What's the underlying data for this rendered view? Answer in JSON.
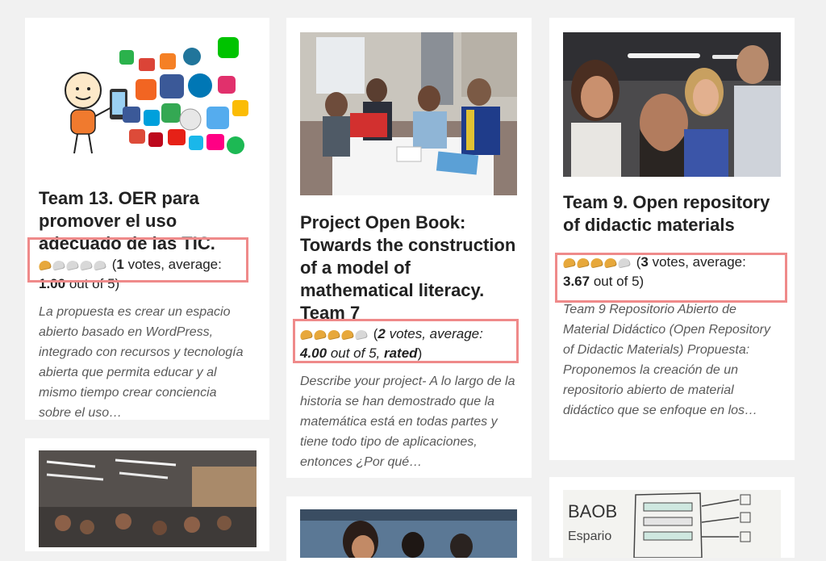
{
  "posts": [
    {
      "title": "Team 13. OER para promover el uso adecuado de las TIC.",
      "rating": {
        "filled": 1,
        "total": 5,
        "votes": "1",
        "votes_word": " votes, average: ",
        "average": "1.00",
        "out_of": " out of 5)",
        "rated": ""
      },
      "excerpt": "La propuesta es crear un espacio abierto basado en WordPress, integrado con recursos y tecnología abierta que permita educar y al mismo tiempo crear conciencia sobre el uso…"
    },
    {
      "title": "Project Open Book: Towards the construction of a model of mathematical literacy. Team 7",
      "rating": {
        "filled": 4,
        "total": 5,
        "votes": "2",
        "votes_word": " votes, average: ",
        "average": "4.00",
        "out_of": " out of 5, ",
        "rated": "rated"
      },
      "excerpt": "Describe your project- A lo largo de la historia se han demostrado que la matemática está en todas partes y tiene todo tipo de aplicaciones, entonces ¿Por qué…"
    },
    {
      "title": "Team 9. Open repository of didactic materials",
      "rating": {
        "filled": 3.67,
        "total": 5,
        "votes": "3",
        "votes_word": " votes, average: ",
        "average": "3.67",
        "out_of": " out of 5)",
        "rated": ""
      },
      "excerpt": "Team 9 Repositorio Abierto de Material Didáctico (Open Repository of Didactic Materials) Propuesta: Proponemos la creación de un repositorio abierto de material didáctico que se enfoque en los…"
    }
  ],
  "bottom_thumb_text": [
    "BAOB",
    "Espario"
  ],
  "colors": {
    "highlight": "#ef8a8a",
    "star_on": "#e7a83b",
    "star_off": "#d8d8d8",
    "page_bg": "#f1f1f1"
  }
}
